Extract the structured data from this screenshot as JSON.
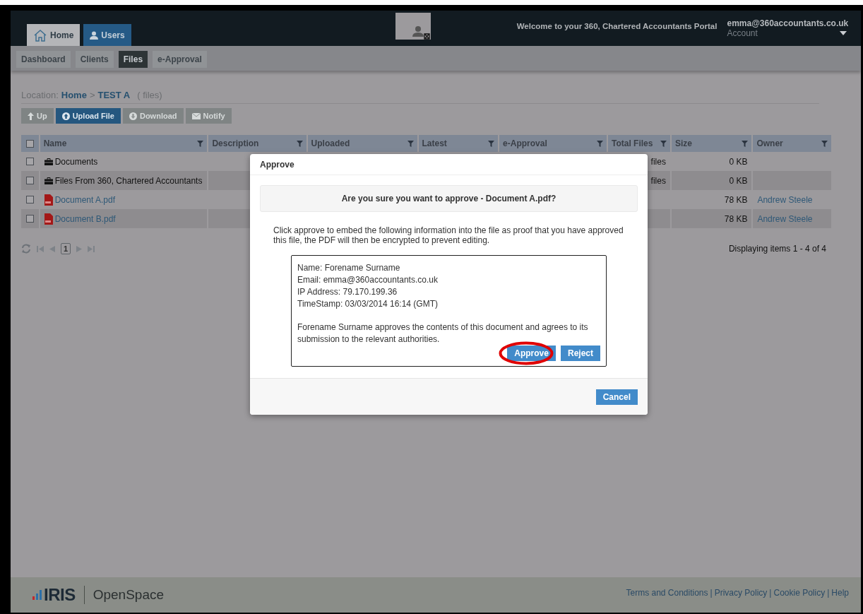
{
  "header": {
    "tabs": [
      {
        "label": "Home",
        "selected": true
      },
      {
        "label": "Users",
        "selected": false
      }
    ],
    "welcome": "Welcome to your 360, Chartered Accountants Portal",
    "account": {
      "email": "emma@360accountants.co.uk",
      "label": "Account"
    }
  },
  "subnav": [
    {
      "label": "Dashboard",
      "selected": false
    },
    {
      "label": "Clients",
      "selected": false
    },
    {
      "label": "Files",
      "selected": true
    },
    {
      "label": "e-Approval",
      "selected": false
    }
  ],
  "location": {
    "label": "Location:",
    "path": [
      "Home",
      "TEST A"
    ],
    "separator": ">",
    "suffix": "( files)"
  },
  "toolbar": [
    {
      "label": "Up",
      "disabled": true
    },
    {
      "label": "Upload File",
      "disabled": false
    },
    {
      "label": "Download",
      "disabled": true
    },
    {
      "label": "Notify",
      "disabled": true
    }
  ],
  "table": {
    "all_checked": false,
    "columns": [
      "Name",
      "Description",
      "Uploaded",
      "Latest",
      "e-Approval",
      "Total Files",
      "Size",
      "Owner"
    ],
    "rows": [
      {
        "kind": "folder",
        "checked": false,
        "name": "Documents",
        "total_files": "files",
        "size": "0 KB",
        "owner": ""
      },
      {
        "kind": "folder",
        "checked": false,
        "name": "Files From 360, Chartered Accountants",
        "total_files": "files",
        "size": "0 KB",
        "owner": ""
      },
      {
        "kind": "pdf",
        "checked": false,
        "name": "Document A.pdf",
        "total_files": "",
        "size": "78 KB",
        "owner": "Andrew Steele"
      },
      {
        "kind": "pdf",
        "checked": false,
        "name": "Document B.pdf",
        "total_files": "",
        "size": "78 KB",
        "owner": "Andrew Steele"
      }
    ]
  },
  "pager": {
    "page": "1",
    "summary": "Displaying items 1 - 4 of 4"
  },
  "dialog": {
    "title": "Approve",
    "question": "Are you sure you want to approve - Document A.pdf?",
    "intro": "Click approve to embed the following information into the file as proof that you have approved this file, the PDF will then be encrypted to prevent editing.",
    "details": [
      "Name: Forename Surname",
      "Email: emma@360accountants.co.uk",
      "IP Address: 79.170.199.36",
      "TimeStamp: 03/03/2014 16:14 (GMT)"
    ],
    "statement": "Forename Surname approves the contents of this document and agrees to its submission to the relevant authorities.",
    "buttons": [
      {
        "label": "Approve",
        "circled": true
      },
      {
        "label": "Reject",
        "circled": false
      }
    ],
    "cancel": "Cancel"
  },
  "footer": {
    "brand": "IRIS",
    "product": "OpenSpace",
    "links": [
      "Terms and Conditions",
      "Privacy Policy",
      "Cookie Policy",
      "Help"
    ],
    "separator": "|"
  }
}
